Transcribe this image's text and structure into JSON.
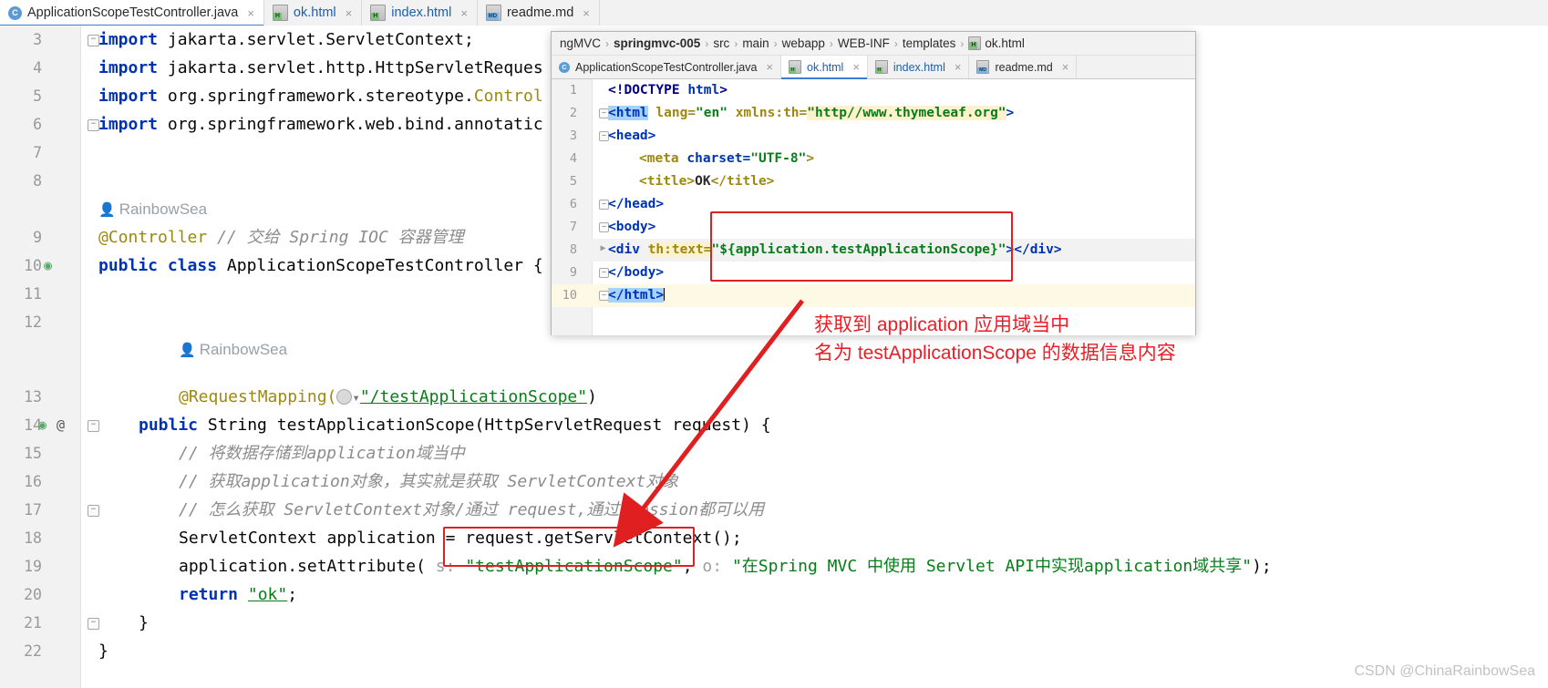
{
  "outer_tabs": [
    {
      "label": "ApplicationScopeTestController.java",
      "icon": "java-class-icon",
      "active": true,
      "close": "×"
    },
    {
      "label": "ok.html",
      "icon": "html-file-icon",
      "active": false,
      "close": "×"
    },
    {
      "label": "index.html",
      "icon": "html-file-icon",
      "active": false,
      "close": "×"
    },
    {
      "label": "readme.md",
      "icon": "markdown-file-icon",
      "active": false,
      "close": "×"
    }
  ],
  "java_editor": {
    "author_tag_1": "RainbowSea",
    "author_tag_2": "RainbowSea",
    "lines": [
      {
        "num": "3",
        "code": "import jakarta.servlet.ServletContext;"
      },
      {
        "num": "4",
        "code": "import jakarta.servlet.http.HttpServletReques"
      },
      {
        "num": "5",
        "code": "import org.springframework.stereotype.Control"
      },
      {
        "num": "6",
        "code": "import org.springframework.web.bind.annotatic"
      },
      {
        "num": "7",
        "code": ""
      },
      {
        "num": "8",
        "code": ""
      },
      {
        "num": "9",
        "code": "@Controller // 交给 Spring IOC 容器管理"
      },
      {
        "num": "10",
        "code": "public class ApplicationScopeTestController {"
      },
      {
        "num": "11",
        "code": ""
      },
      {
        "num": "12",
        "code": ""
      },
      {
        "num": "13",
        "code": "@RequestMapping(\"/testApplicationScope\")"
      },
      {
        "num": "14",
        "code": "public String testApplicationScope(HttpServletRequest request) {"
      },
      {
        "num": "15",
        "code": "// 将数据存储到application域当中"
      },
      {
        "num": "16",
        "code": "// 获取application对象，其实就是获取 ServletContext对象"
      },
      {
        "num": "17",
        "code": "// 怎么获取 ServletContext对象/通过 request,通过 session都可以用"
      },
      {
        "num": "18",
        "code": "ServletContext application = request.getServletContext();"
      },
      {
        "num": "19",
        "code": "application.setAttribute( s: \"testApplicationScope\", o: \"在Spring MVC 中使用 Servlet API中实现application域共享\");"
      },
      {
        "num": "20",
        "code": "return \"ok\";"
      },
      {
        "num": "21",
        "code": "}"
      },
      {
        "num": "22",
        "code": "}"
      }
    ],
    "keywords": {
      "import": "import",
      "public": "public",
      "class": "class",
      "return": "return",
      "string": "String"
    },
    "annotation_controller": "@Controller",
    "comment_controller": "// 交给 Spring IOC 容器管理",
    "class_name": "ApplicationScopeTestController",
    "request_mapping": "@RequestMapping(",
    "mapping_path": "\"/testApplicationScope\"",
    "method_signature_pre": "public String testApplicationScope(HttpServletRequest request) {",
    "comment_15": "// 将数据存储到application域当中",
    "comment_16": "// 获取application对象，其实就是获取 ServletContext对象",
    "comment_17": "// 怎么获取 ServletContext对象/通过 request,通过 session都可以用",
    "line18": "ServletContext application = request.getServletContext();",
    "line19_pre": "application.setAttribute(",
    "line19_hint_s": "s:",
    "line19_key": "\"testApplicationScope\"",
    "line19_comma": ",",
    "line19_hint_o": "o:",
    "line19_val": "\"在Spring MVC 中使用 Servlet API中实现application域共享\"",
    "line19_end": ");",
    "line20_return": "return",
    "line20_val": "\"ok\"",
    "line20_end": ";",
    "brace": "}"
  },
  "inner_window": {
    "breadcrumb": [
      {
        "label": "ngMVC",
        "bold": false,
        "icon": ""
      },
      {
        "label": "springmvc-005",
        "bold": true,
        "icon": ""
      },
      {
        "label": "src",
        "bold": false,
        "icon": ""
      },
      {
        "label": "main",
        "bold": false,
        "icon": ""
      },
      {
        "label": "webapp",
        "bold": false,
        "icon": ""
      },
      {
        "label": "WEB-INF",
        "bold": false,
        "icon": ""
      },
      {
        "label": "templates",
        "bold": false,
        "icon": ""
      },
      {
        "label": "ok.html",
        "bold": false,
        "icon": "html-file-icon"
      }
    ],
    "separator": "›",
    "tabs": [
      {
        "label": "ApplicationScopeTestController.java",
        "icon": "java-class-icon",
        "active": false,
        "close": "×"
      },
      {
        "label": "ok.html",
        "icon": "html-file-icon",
        "active": true,
        "close": "×"
      },
      {
        "label": "index.html",
        "icon": "html-file-icon",
        "active": false,
        "close": "×"
      },
      {
        "label": "readme.md",
        "icon": "markdown-file-icon",
        "active": false,
        "close": "×"
      }
    ],
    "lines": [
      {
        "num": "1",
        "code": "<!DOCTYPE html>"
      },
      {
        "num": "2",
        "code": "<html lang=\"en\" xmlns:th=\"http//www.thymeleaf.org\">"
      },
      {
        "num": "3",
        "code": "<head>"
      },
      {
        "num": "4",
        "code": "    <meta charset=\"UTF-8\">"
      },
      {
        "num": "5",
        "code": "    <title>OK</title>"
      },
      {
        "num": "6",
        "code": "</head>"
      },
      {
        "num": "7",
        "code": "<body>"
      },
      {
        "num": "8",
        "code": "<div th:text=\"${application.testApplicationScope}\"></div>"
      },
      {
        "num": "9",
        "code": "</body>"
      },
      {
        "num": "10",
        "code": "</html>"
      }
    ],
    "tokens": {
      "doctype": "<!DOCTYPE ",
      "doctype_name": "html",
      "doctype_close": ">",
      "html_open": "<html",
      "lang_attr": " lang=",
      "lang_val": "\"en\"",
      "xmlns_attr": " xmlns:th=",
      "xmlns_val": "\"http//www.thymeleaf.org\"",
      "gt": ">",
      "head_open": "<head>",
      "meta_open": "<meta ",
      "charset_attr": "charset=",
      "charset_val": "\"UTF-8\"",
      "title_open": "<title>",
      "title_text": "OK",
      "title_close": "</title>",
      "head_close": "</head>",
      "body_open": "<body>",
      "div_open": "<div ",
      "thtext_attr": "th:text=",
      "thtext_val": "\"${application.testApplicationScope}\"",
      "div_close": "></div>",
      "body_close": "</body>",
      "html_close": "</html>"
    }
  },
  "annotations": {
    "line_1": "获取到 application 应用域当中",
    "line_2": "名为 testApplicationScope 的数据信息内容",
    "color": "#ee1c25",
    "box_color": "#e02020"
  },
  "watermark": "CSDN @ChinaRainbowSea"
}
